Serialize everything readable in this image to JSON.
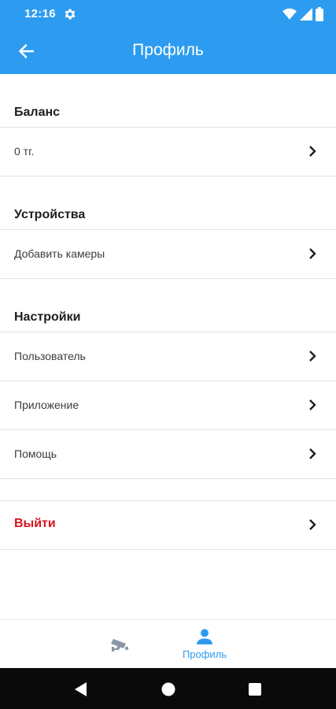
{
  "status_bar": {
    "time": "12:16"
  },
  "app_bar": {
    "title": "Профиль"
  },
  "sections": {
    "balance": {
      "title": "Баланс",
      "value": "0 тг."
    },
    "devices": {
      "title": "Устройства",
      "add_cameras": "Добавить камеры"
    },
    "settings": {
      "title": "Настройки",
      "user": "Пользователь",
      "app": "Приложение",
      "help": "Помощь"
    }
  },
  "logout": {
    "label": "Выйти"
  },
  "bottom_nav": {
    "profile_label": "Профиль"
  },
  "colors": {
    "primary": "#2d9cf0",
    "danger": "#d9141f",
    "divider": "#e2e2e2"
  }
}
